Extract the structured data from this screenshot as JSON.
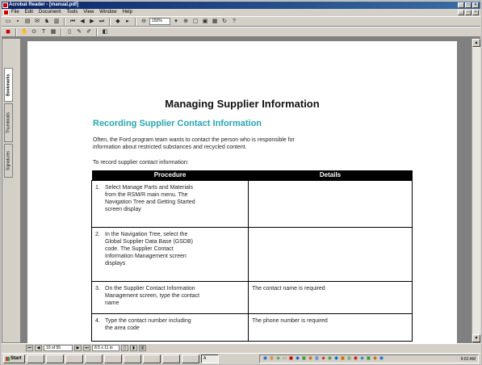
{
  "window": {
    "title": "Acrobat Reader - [manual.pdf]",
    "caption_buttons": [
      "_",
      "□",
      "×"
    ],
    "doc_caption_buttons": [
      "_",
      "□",
      "×"
    ]
  },
  "menu": [
    "File",
    "Edit",
    "Document",
    "Tools",
    "View",
    "Window",
    "Help"
  ],
  "toolbar": {
    "zoom": "150%"
  },
  "nav_tabs": [
    "Bookmarks",
    "Thumbnails",
    "Signatures"
  ],
  "status": {
    "page_label": "10 of 55",
    "page_size": "8.5 x 11 in"
  },
  "taskbar": {
    "start": "Start",
    "active_task": "A",
    "clock": "9:02 AM"
  },
  "document": {
    "title": "Managing Supplier Information",
    "section_title": "Recording Supplier Contact Information",
    "intro_lines": [
      "Often, the Ford program team wants to contact the person who is responsible for",
      "information about restricted substances and recycled content."
    ],
    "lead_in": "To record supplier contact information:",
    "table": {
      "headers": [
        "Procedure",
        "Details"
      ],
      "rows": [
        {
          "num": "1.",
          "lines": [
            "Select Manage Parts and Materials",
            "from the RSM/R main menu. The",
            "Navigation Tree and Getting Started",
            "screen display"
          ],
          "details": ""
        },
        {
          "num": "2.",
          "lines": [
            "In the Navigation Tree, select the",
            "Global Supplier Data Base (GSDB)",
            "code. The Supplier Contact",
            "Information Management screen",
            "displays"
          ],
          "details": ""
        },
        {
          "num": "3.",
          "lines": [
            "On the Supplier Contact Information",
            "Management screen, type the contact",
            "name"
          ],
          "details": "The contact name is required"
        },
        {
          "num": "4.",
          "lines": [
            "Type the contact number including",
            "the area code"
          ],
          "details": "The phone number is required"
        }
      ]
    }
  }
}
